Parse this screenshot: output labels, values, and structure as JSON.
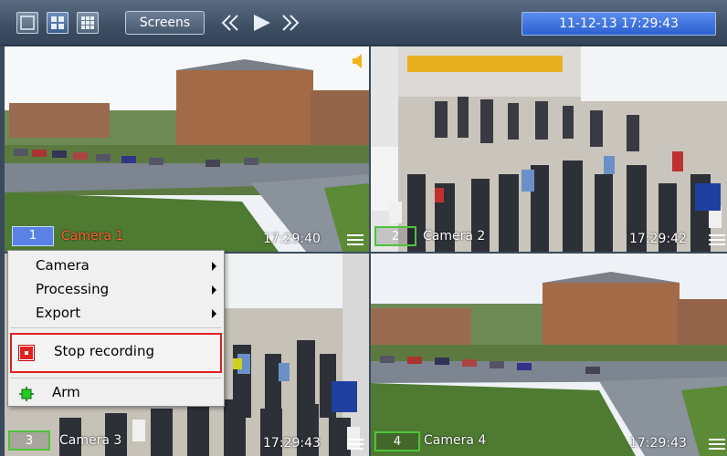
{
  "toolbar": {
    "screens_label": "Screens",
    "datetime": "11-12-13  17:29:43"
  },
  "cameras": [
    {
      "number": "1",
      "name": "Camera 1",
      "time": "17:29:40"
    },
    {
      "number": "2",
      "name": "Camera 2",
      "time": "17:29:42"
    },
    {
      "number": "3",
      "name": "Camera 3",
      "time": "17:29:43"
    },
    {
      "number": "4",
      "name": "Camera 4",
      "time": "17:29:43"
    }
  ],
  "context_menu": {
    "items": [
      {
        "label": "Camera"
      },
      {
        "label": "Processing"
      },
      {
        "label": "Export"
      }
    ],
    "stop_recording": "Stop recording",
    "arm": "Arm"
  },
  "colors": {
    "selected_border": "#6cd23a",
    "camera1_name": "#ff6030",
    "stop_red": "#e02020",
    "arm_green": "#22cc22"
  },
  "icons": [
    "layout-1x1-icon",
    "layout-2x2-icon",
    "layout-3x3-icon",
    "rewind-icon",
    "play-icon",
    "fast-forward-icon",
    "speaker-icon",
    "hamburger-menu-icon",
    "stop-recording-icon",
    "arm-icon"
  ]
}
